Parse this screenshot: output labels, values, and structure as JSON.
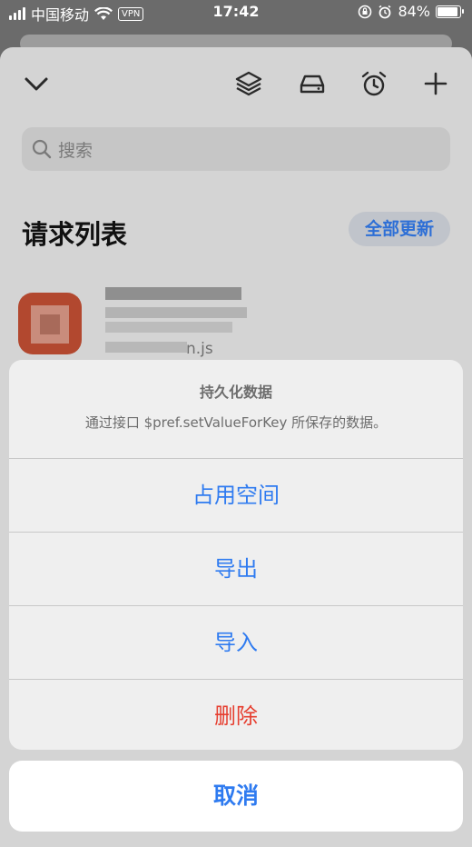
{
  "status_bar": {
    "carrier": "中国移动",
    "vpn": "VPN",
    "time": "17:42",
    "battery": "84%",
    "battery_level": 0.84
  },
  "toolbar": {
    "icons": [
      "chevron-down-icon",
      "layers-icon",
      "drive-icon",
      "alarm-icon",
      "plus-icon"
    ]
  },
  "search": {
    "placeholder": "搜索"
  },
  "list": {
    "title": "请求列表",
    "update_all": "全部更新",
    "item": {
      "subtitle": "n.js"
    }
  },
  "action_sheet": {
    "title": "持久化数据",
    "message": "通过接口 $pref.setValueForKey 所保存的数据。",
    "buttons": [
      "占用空间",
      "导出",
      "导入",
      "删除"
    ],
    "destructive_color": "#e63e2f",
    "accent_color": "#2f7bf0",
    "cancel": "取消"
  }
}
